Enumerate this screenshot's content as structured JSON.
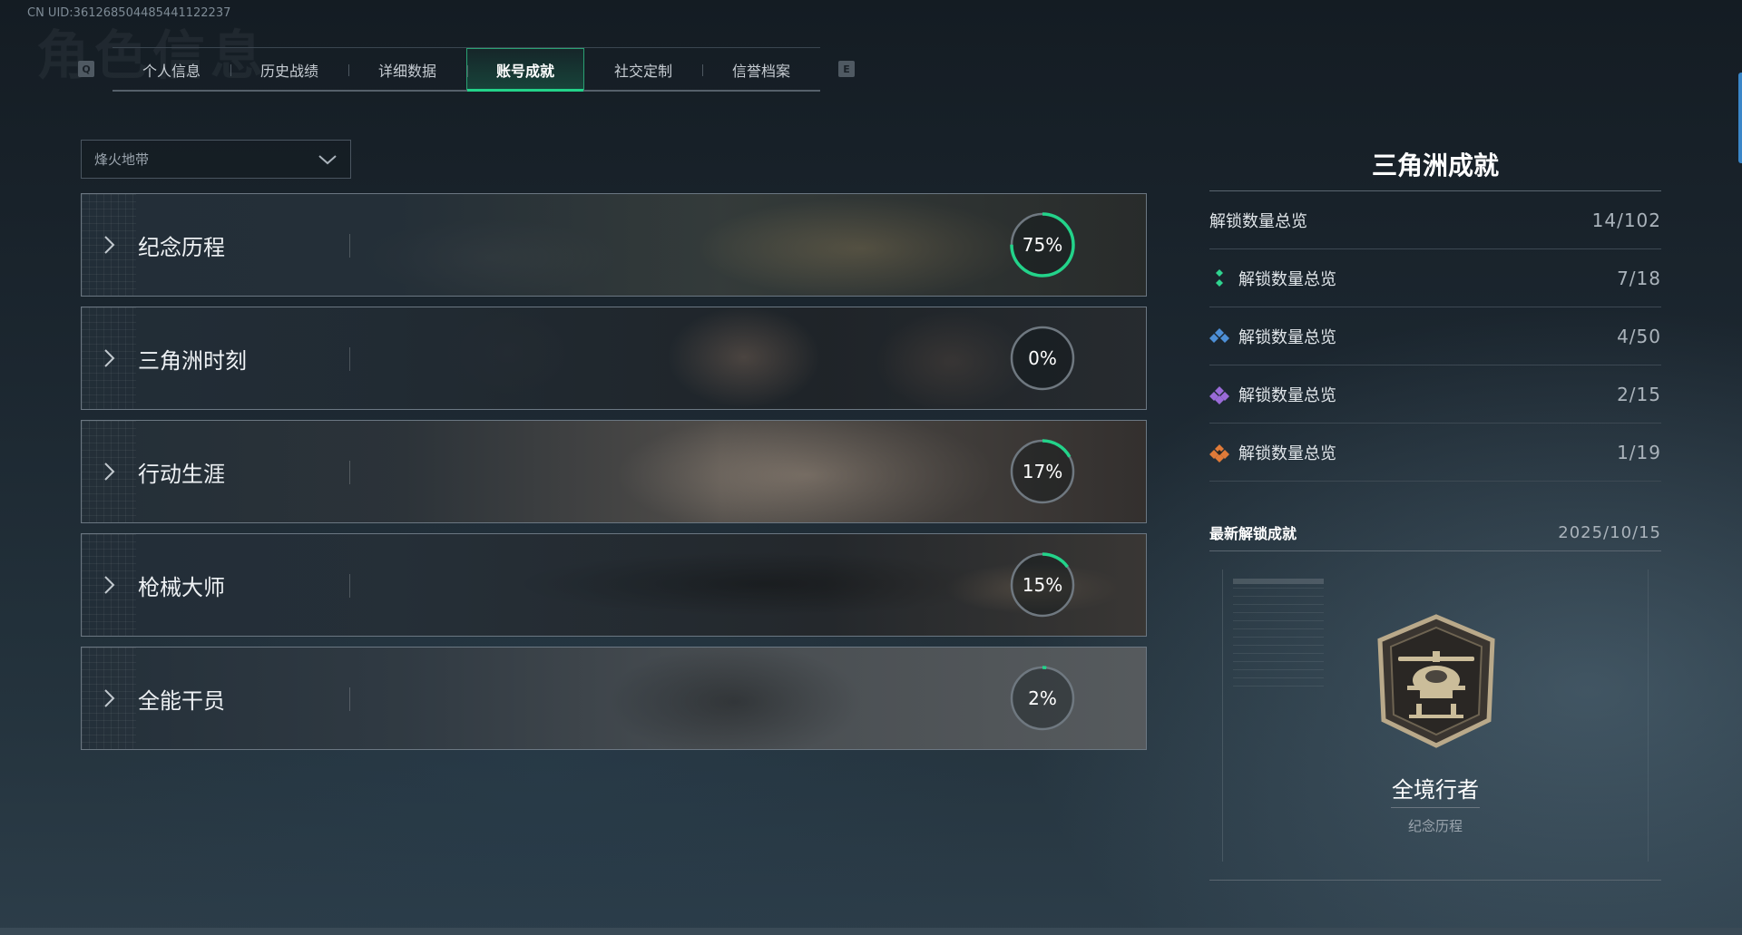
{
  "header": {
    "uid": "CN UID:361268504485441122237",
    "bg_title": "角色信息",
    "key_left": "Q",
    "key_right": "E"
  },
  "tabs": [
    {
      "label": "个人信息",
      "active": false
    },
    {
      "label": "历史战绩",
      "active": false
    },
    {
      "label": "详细数据",
      "active": false
    },
    {
      "label": "账号成就",
      "active": true
    },
    {
      "label": "社交定制",
      "active": false
    },
    {
      "label": "信誉档案",
      "active": false
    }
  ],
  "dropdown": {
    "selected": "烽火地带"
  },
  "categories": [
    {
      "name": "纪念历程",
      "percent": 75
    },
    {
      "name": "三角洲时刻",
      "percent": 0
    },
    {
      "name": "行动生涯",
      "percent": 17
    },
    {
      "name": "枪械大师",
      "percent": 15
    },
    {
      "name": "全能干员",
      "percent": 2
    }
  ],
  "panel": {
    "title": "三角洲成就",
    "stats": [
      {
        "label": "解锁数量总览",
        "value": "14/102",
        "icon": "none"
      },
      {
        "label": "解锁数量总览",
        "value": "7/18",
        "icon": "green-diamond-icon"
      },
      {
        "label": "解锁数量总览",
        "value": "4/50",
        "icon": "blue-diamond-icon"
      },
      {
        "label": "解锁数量总览",
        "value": "2/15",
        "icon": "purple-diamond-icon"
      },
      {
        "label": "解锁数量总览",
        "value": "1/19",
        "icon": "orange-diamond-icon"
      }
    ],
    "latest_label": "最新解锁成就",
    "latest_date": "2025/10/15",
    "achievement_name": "全境行者",
    "achievement_category": "纪念历程"
  },
  "colors": {
    "accent": "#23d38a",
    "ring_track": "#6f7880",
    "green": "#2fd38f",
    "blue": "#4d8fd6",
    "purple": "#9a6bd8",
    "orange": "#e07a38"
  }
}
